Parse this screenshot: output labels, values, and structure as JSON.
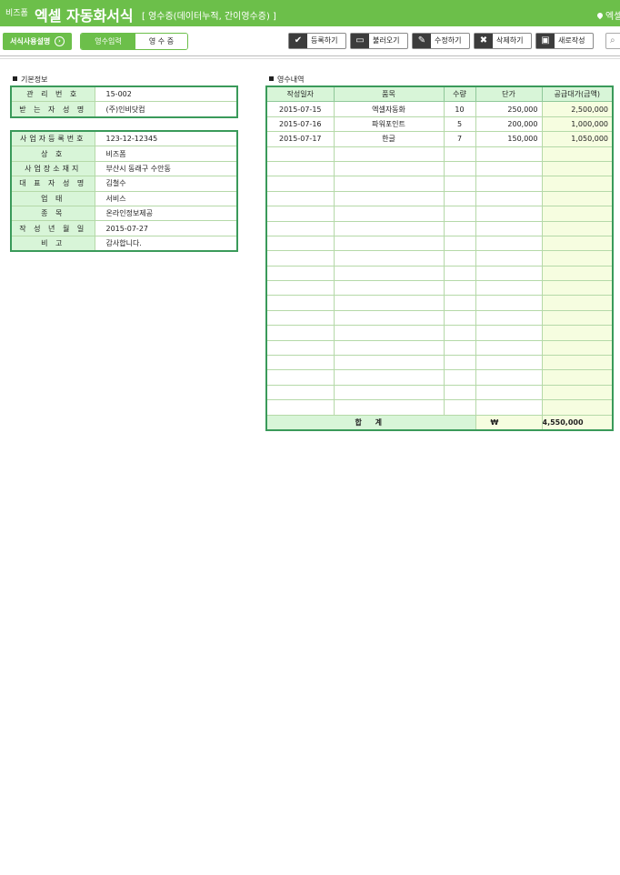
{
  "header": {
    "brand_small": "비즈폼",
    "title": "엑셀 자동화서식",
    "subtitle": "[ 영수증(데이터누적, 간이영수증) ]",
    "location": "엑셀"
  },
  "toolbar": {
    "guide_label": "서식사용설명",
    "tabs": [
      {
        "label": "영수입력"
      },
      {
        "label": "영 수 증"
      }
    ],
    "actions": [
      {
        "label": "등록하기",
        "icon": "check-icon"
      },
      {
        "label": "불러오기",
        "icon": "monitor-icon"
      },
      {
        "label": "수정하기",
        "icon": "edit-icon"
      },
      {
        "label": "삭제하기",
        "icon": "delete-icon"
      },
      {
        "label": "새로작성",
        "icon": "new-doc-icon"
      }
    ]
  },
  "basic_info": {
    "title": "기본정보",
    "rows_a": [
      {
        "label": "관 리 번 호",
        "value": "15-002"
      },
      {
        "label": "받 는 자 성 명",
        "value": "(주)인비닷컴"
      }
    ],
    "rows_b": [
      {
        "label": "사업자등록번호",
        "value": "123-12-12345"
      },
      {
        "label": "상 호",
        "value": "비즈폼"
      },
      {
        "label": "사업장소재지",
        "value": "부산시 동래구 수안동"
      },
      {
        "label": "대 표 자 성 명",
        "value": "김철수"
      },
      {
        "label": "업 태",
        "value": "서비스"
      },
      {
        "label": "종 목",
        "value": "온라인정보제공"
      },
      {
        "label": "작 성 년 월 일",
        "value": "2015-07-27"
      },
      {
        "label": "비 고",
        "value": "감사합니다."
      }
    ]
  },
  "receipt": {
    "title": "영수내역",
    "columns": [
      "작성일자",
      "품목",
      "수량",
      "단가",
      "공급대가(금액)"
    ],
    "rows": [
      {
        "date": "2015-07-15",
        "item": "엑셀자동화",
        "qty": "10",
        "price": "250,000",
        "amount": "2,500,000"
      },
      {
        "date": "2015-07-16",
        "item": "파워포인트",
        "qty": "5",
        "price": "200,000",
        "amount": "1,000,000"
      },
      {
        "date": "2015-07-17",
        "item": "한글",
        "qty": "7",
        "price": "150,000",
        "amount": "1,050,000"
      }
    ],
    "total_label": "합 계",
    "currency": "₩",
    "total": "4,550,000"
  }
}
